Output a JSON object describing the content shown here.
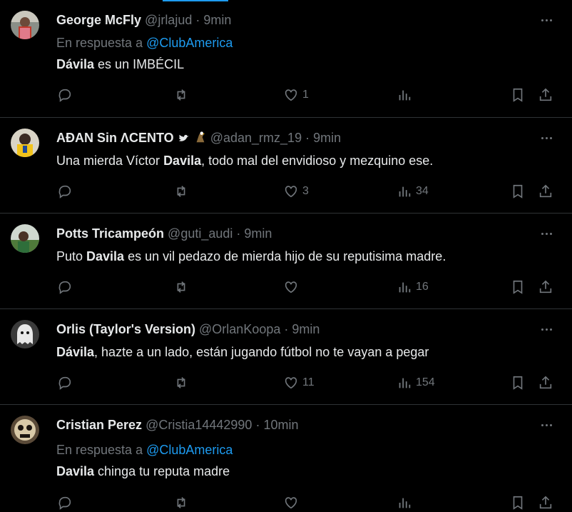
{
  "tweets": [
    {
      "name": "George McFly",
      "handle": "@jrlajud",
      "time": "9min",
      "reply_prefix": "En respuesta a",
      "reply_to": "@ClubAmerica",
      "text_bold": "Dávila",
      "text_rest": " es un IMBÉCIL",
      "likes": "1",
      "views": ""
    },
    {
      "name": "ΑÐΑΝ Sin ΛCENTO",
      "handle": "@adan_rmz_19",
      "time": "9min",
      "text_pre": "Una mierda Víctor ",
      "text_bold": "Davila",
      "text_rest": ", todo mal del envidioso y mezquino ese.",
      "likes": "3",
      "views": "34"
    },
    {
      "name": "Potts Tricampeón",
      "handle": "@guti_audi",
      "time": "9min",
      "text_pre": "Puto ",
      "text_bold": "Davila",
      "text_rest": " es un vil pedazo de mierda hijo de su reputisima madre.",
      "likes": "",
      "views": "16"
    },
    {
      "name": "Orlis (Taylor's Version)",
      "handle": "@OrlanKoopa",
      "time": "9min",
      "text_bold": "Dávila",
      "text_rest": ", hazte a un lado, están jugando fútbol no te vayan a pegar",
      "likes": "11",
      "views": "154"
    },
    {
      "name": "Cristian Perez",
      "handle": "@Cristia14442990",
      "time": "10min",
      "reply_prefix": "En respuesta a",
      "reply_to": "@ClubAmerica",
      "text_bold": "Davila",
      "text_rest": " chinga tu reputa madre",
      "likes": "",
      "views": ""
    }
  ],
  "separator": "·",
  "colors": {
    "background": "#000000",
    "text": "#e7e9ea",
    "muted": "#71767b",
    "accent": "#1d9bf0",
    "divider": "#2f3336"
  }
}
